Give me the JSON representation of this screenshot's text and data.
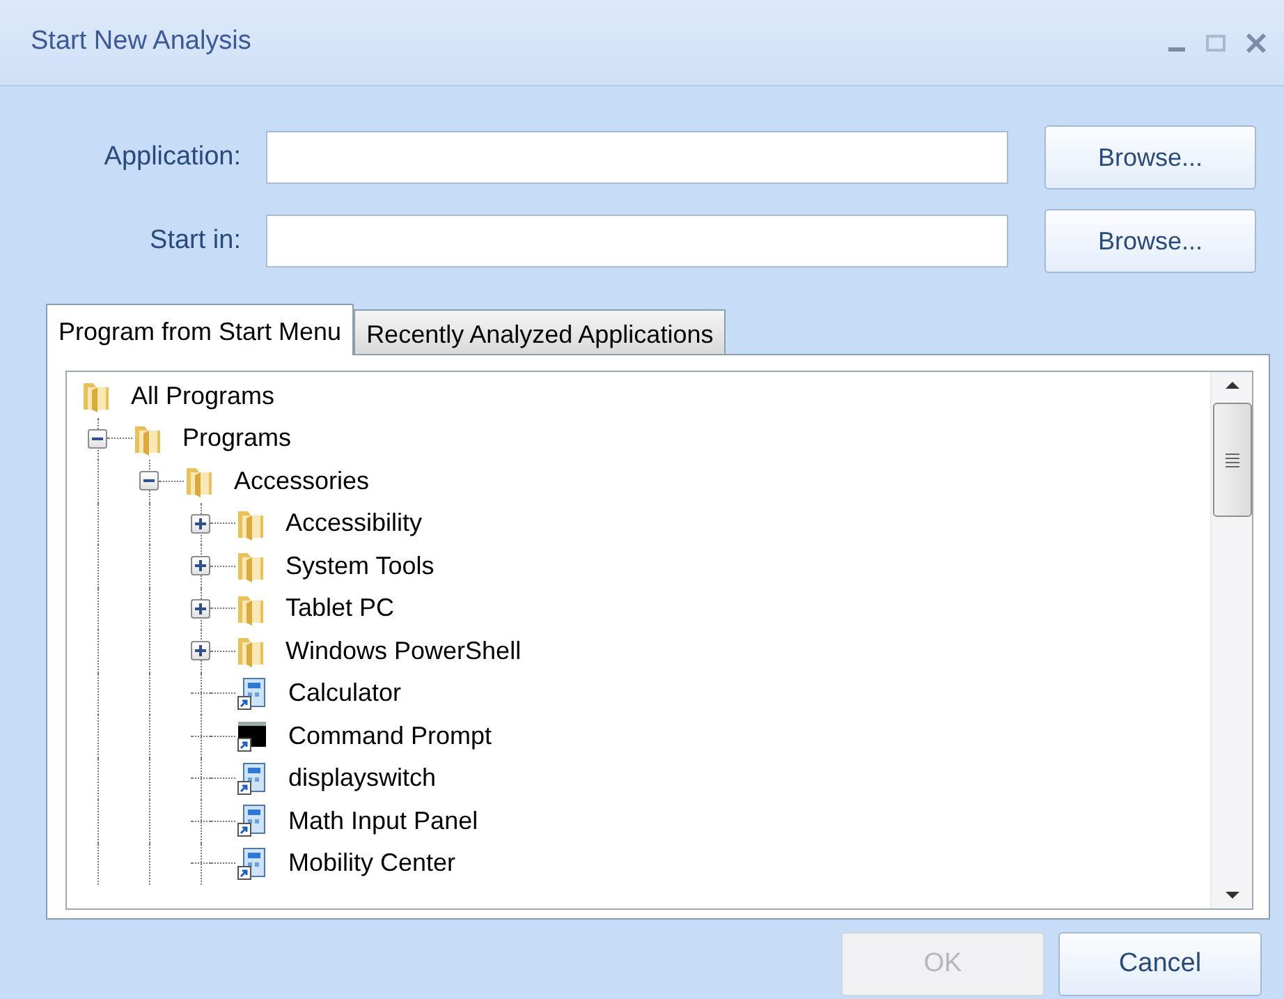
{
  "window": {
    "title": "Start New Analysis"
  },
  "fields": [
    {
      "label": "Application:",
      "button": "Browse..."
    },
    {
      "label": "Start in:",
      "button": "Browse..."
    }
  ],
  "tabs": [
    {
      "label": "Program from Start Menu",
      "selected": true
    },
    {
      "label": "Recently Analyzed Applications",
      "selected": false
    }
  ],
  "tree": [
    {
      "label": "All Programs",
      "kind": "folder",
      "children": [
        {
          "label": "Programs",
          "kind": "folder",
          "expanded": true,
          "children": [
            {
              "label": "Accessories",
              "kind": "folder",
              "expanded": true,
              "children": [
                {
                  "label": "Accessibility",
                  "kind": "folder",
                  "expanded": false
                },
                {
                  "label": "System Tools",
                  "kind": "folder",
                  "expanded": false
                },
                {
                  "label": "Tablet PC",
                  "kind": "folder",
                  "expanded": false
                },
                {
                  "label": "Windows PowerShell",
                  "kind": "folder",
                  "expanded": false
                },
                {
                  "label": "Calculator",
                  "kind": "shortcut"
                },
                {
                  "label": "Command Prompt",
                  "kind": "console"
                },
                {
                  "label": "displayswitch",
                  "kind": "shortcut"
                },
                {
                  "label": "Math Input Panel",
                  "kind": "shortcut"
                },
                {
                  "label": "Mobility Center",
                  "kind": "shortcut"
                }
              ]
            }
          ]
        }
      ]
    }
  ],
  "buttons": [
    {
      "label": "OK",
      "disabled": true
    },
    {
      "label": "Cancel",
      "disabled": false
    }
  ]
}
